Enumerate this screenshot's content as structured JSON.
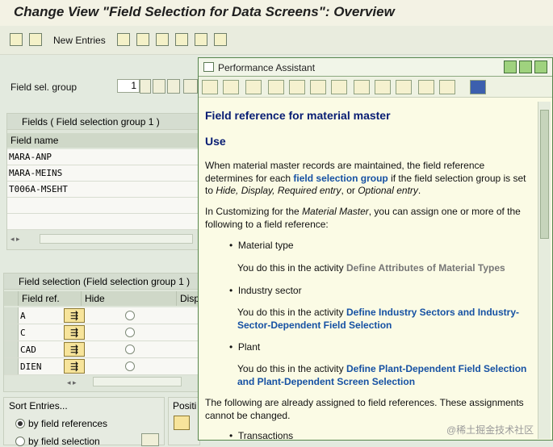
{
  "title": "Change View \"Field Selection for Data Screens\": Overview",
  "toolbar": {
    "new_entries": "New Entries"
  },
  "field_sel_group": {
    "label": "Field sel. group",
    "value": "1"
  },
  "fields_table": {
    "header": "Fields  ( Field selection group    1 )",
    "col": "Field name",
    "rows": [
      "MARA-ANP",
      "MARA-MEINS",
      "T006A-MSEHT"
    ]
  },
  "selection_table": {
    "header": "Field selection (Field selection group    1 )",
    "cols": [
      "Field ref.",
      "Hide",
      "Disp"
    ],
    "rows": [
      "A",
      "C",
      "CAD",
      "DIEN"
    ]
  },
  "sort": {
    "header": "Sort Entries...",
    "opt1": "by field references",
    "opt2": "by field selection",
    "pos": "Positi"
  },
  "pa": {
    "title": "Performance Assistant",
    "heading": "Field reference for material master",
    "use": "Use",
    "p1a": "When material master records are maintained, the field reference determines for each ",
    "p1link": "field selection group",
    "p1b": " if the field selection group is set to ",
    "p1c": "Hide, Display, Required entry",
    "p1d": ", or ",
    "p1e": "Optional entry",
    "p1f": ".",
    "p2a": "In Customizing for the ",
    "p2b": "Material Master",
    "p2c": ", you can assign one or more of the following to a field reference:",
    "b1": "Material type",
    "s1a": "You do this in the activity ",
    "s1link": "Define Attributes of Material Types",
    "b2": "Industry sector",
    "s2a": "You do this in the activity ",
    "s2link": "Define Industry Sectors and Industry-Sector-Dependent Field Selection",
    "b3": "Plant",
    "s3a": "You do this in the activity ",
    "s3link": "Define Plant-Dependent Field Selection and Plant-Dependent Screen Selection",
    "p3": "The following are already assigned to field references. These assignments cannot be changed.",
    "b4": "Transactions"
  },
  "watermark": "@稀土掘金技术社区"
}
